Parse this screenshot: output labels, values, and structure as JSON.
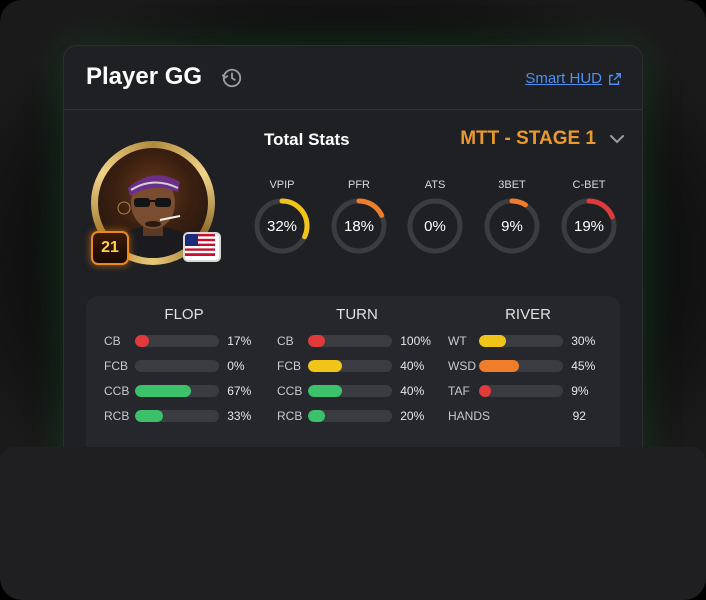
{
  "header": {
    "title": "Player GG",
    "smart_hud_label": "Smart HUD"
  },
  "player": {
    "level": "21",
    "flag": "United States"
  },
  "summary": {
    "total_stats_label": "Total Stats",
    "stage_label": "MTT - STAGE 1"
  },
  "gauges": [
    {
      "label": "VPIP",
      "value": "32%",
      "fraction": 0.32,
      "color": "#f0c419"
    },
    {
      "label": "PFR",
      "value": "18%",
      "fraction": 0.18,
      "color": "#ef7d2a"
    },
    {
      "label": "ATS",
      "value": "0%",
      "fraction": 0.0,
      "color": "#ef7d2a"
    },
    {
      "label": "3BET",
      "value": "9%",
      "fraction": 0.09,
      "color": "#ef7d2a"
    },
    {
      "label": "C-BET",
      "value": "19%",
      "fraction": 0.19,
      "color": "#e03a3a"
    }
  ],
  "streets": [
    {
      "title": "FLOP",
      "rows": [
        {
          "label": "CB",
          "value": "17%",
          "fraction": 0.17,
          "color": "#e03a3a"
        },
        {
          "label": "FCB",
          "value": "0%",
          "fraction": 0.0,
          "color": "#e03a3a"
        },
        {
          "label": "CCB",
          "value": "67%",
          "fraction": 0.67,
          "color": "#3cc06a"
        },
        {
          "label": "RCB",
          "value": "33%",
          "fraction": 0.33,
          "color": "#3cc06a"
        }
      ]
    },
    {
      "title": "TURN",
      "rows": [
        {
          "label": "CB",
          "value": "100%",
          "fraction": 0.2,
          "color": "#e03a3a"
        },
        {
          "label": "FCB",
          "value": "40%",
          "fraction": 0.4,
          "color": "#f0c419"
        },
        {
          "label": "CCB",
          "value": "40%",
          "fraction": 0.4,
          "color": "#3cc06a"
        },
        {
          "label": "RCB",
          "value": "20%",
          "fraction": 0.2,
          "color": "#3cc06a"
        }
      ]
    },
    {
      "title": "RIVER",
      "rows": [
        {
          "label": "WT",
          "value": "30%",
          "fraction": 0.32,
          "color": "#f0c419"
        },
        {
          "label": "WSD",
          "value": "45%",
          "fraction": 0.47,
          "color": "#ef7d2a"
        },
        {
          "label": "TAF",
          "value": "9%",
          "fraction": 0.12,
          "color": "#e03a3a"
        }
      ],
      "hands_label": "HANDS",
      "hands_value": "92"
    }
  ]
}
